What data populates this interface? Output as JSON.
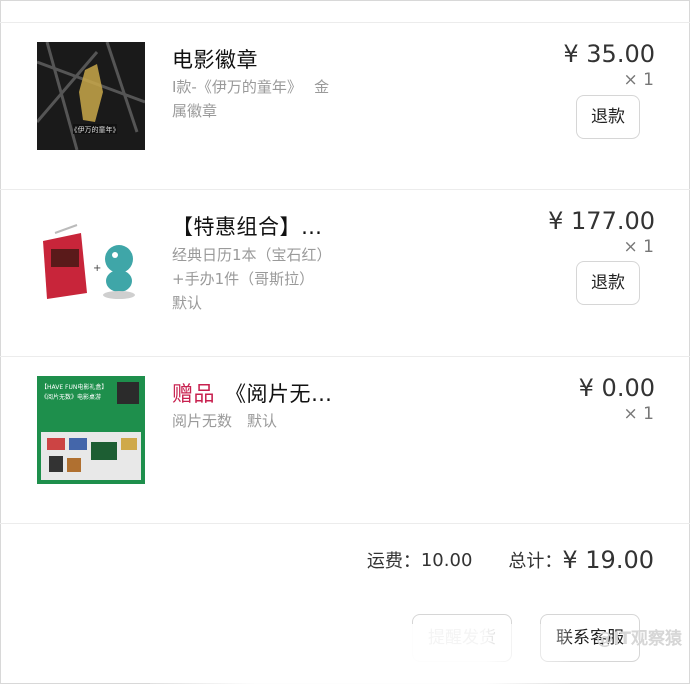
{
  "items": [
    {
      "title": "电影徽章",
      "desc_lines": [
        "I款-《伊万的童年》　 金",
        "属徽章"
      ],
      "thumb_caption": "《伊万的童年》",
      "price": "¥ 35.00",
      "qty": "× 1",
      "refund_label": "退款"
    },
    {
      "title": "【特惠组合】…",
      "desc_lines": [
        "经典日历1本（宝石红）",
        "+手办1件（哥斯拉）",
        "默认"
      ],
      "price": "¥ 177.00",
      "qty": "× 1",
      "refund_label": "退款"
    },
    {
      "gift_tag": "赠品",
      "title": "《阅片无…",
      "desc_lines": [
        "阅片无数　默认"
      ],
      "thumb_caption_1": "【HAVE FUN电影礼盒】",
      "thumb_caption_2": "《阅片无数》电影桌游",
      "price": "¥ 0.00",
      "qty": "× 1"
    }
  ],
  "summary": {
    "shipping_label": "运费：",
    "shipping_value": "10.00",
    "total_label": "总计：",
    "total_value": "¥ 19.00"
  },
  "actions": {
    "remind_label": "提醒发货",
    "contact_label": "联系客服"
  },
  "watermark": "@IT观察猿",
  "colors": {
    "gift": "#c8214f",
    "border": "#d6d6d6"
  }
}
